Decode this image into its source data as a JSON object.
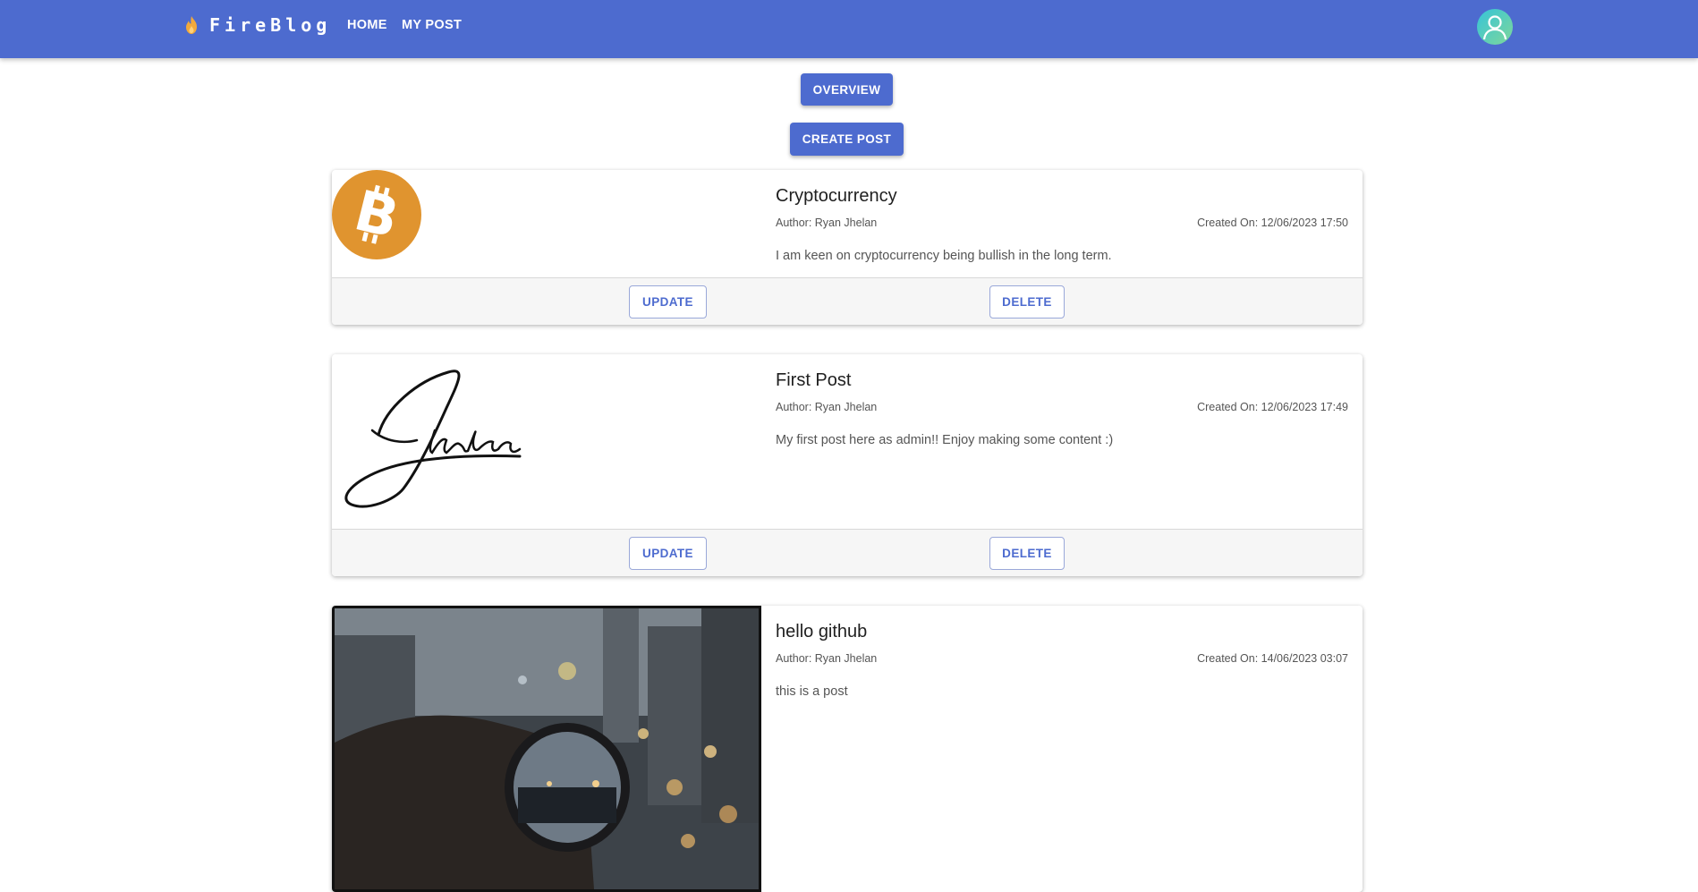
{
  "header": {
    "brand": "FireBlog",
    "nav": {
      "home": "HOME",
      "my_post": "MY POST"
    },
    "colors": {
      "bar": "#4d6bcf",
      "flame": "#f2a93b"
    }
  },
  "actions": {
    "overview": "OVERVIEW",
    "create_post": "CREATE POST"
  },
  "posts": [
    {
      "title": "Cryptocurrency",
      "author": "Author: Ryan Jhelan",
      "created": "Created On: 12/06/2023 17:50",
      "body": "I am keen on cryptocurrency being bullish in the long term.",
      "image": "bitcoin-logo",
      "update_label": "UPDATE",
      "delete_label": "DELETE"
    },
    {
      "title": "First Post",
      "author": "Author: Ryan Jhelan",
      "created": "Created On: 12/06/2023 17:49",
      "body": "My first post here as admin!! Enjoy making some content :)",
      "image": "signature-jhelan",
      "update_label": "UPDATE",
      "delete_label": "DELETE"
    },
    {
      "title": "hello github",
      "author": "Author: Ryan Jhelan",
      "created": "Created On: 14/06/2023 03:07",
      "body": "this is a post",
      "image": "city-lens-photo"
    }
  ]
}
